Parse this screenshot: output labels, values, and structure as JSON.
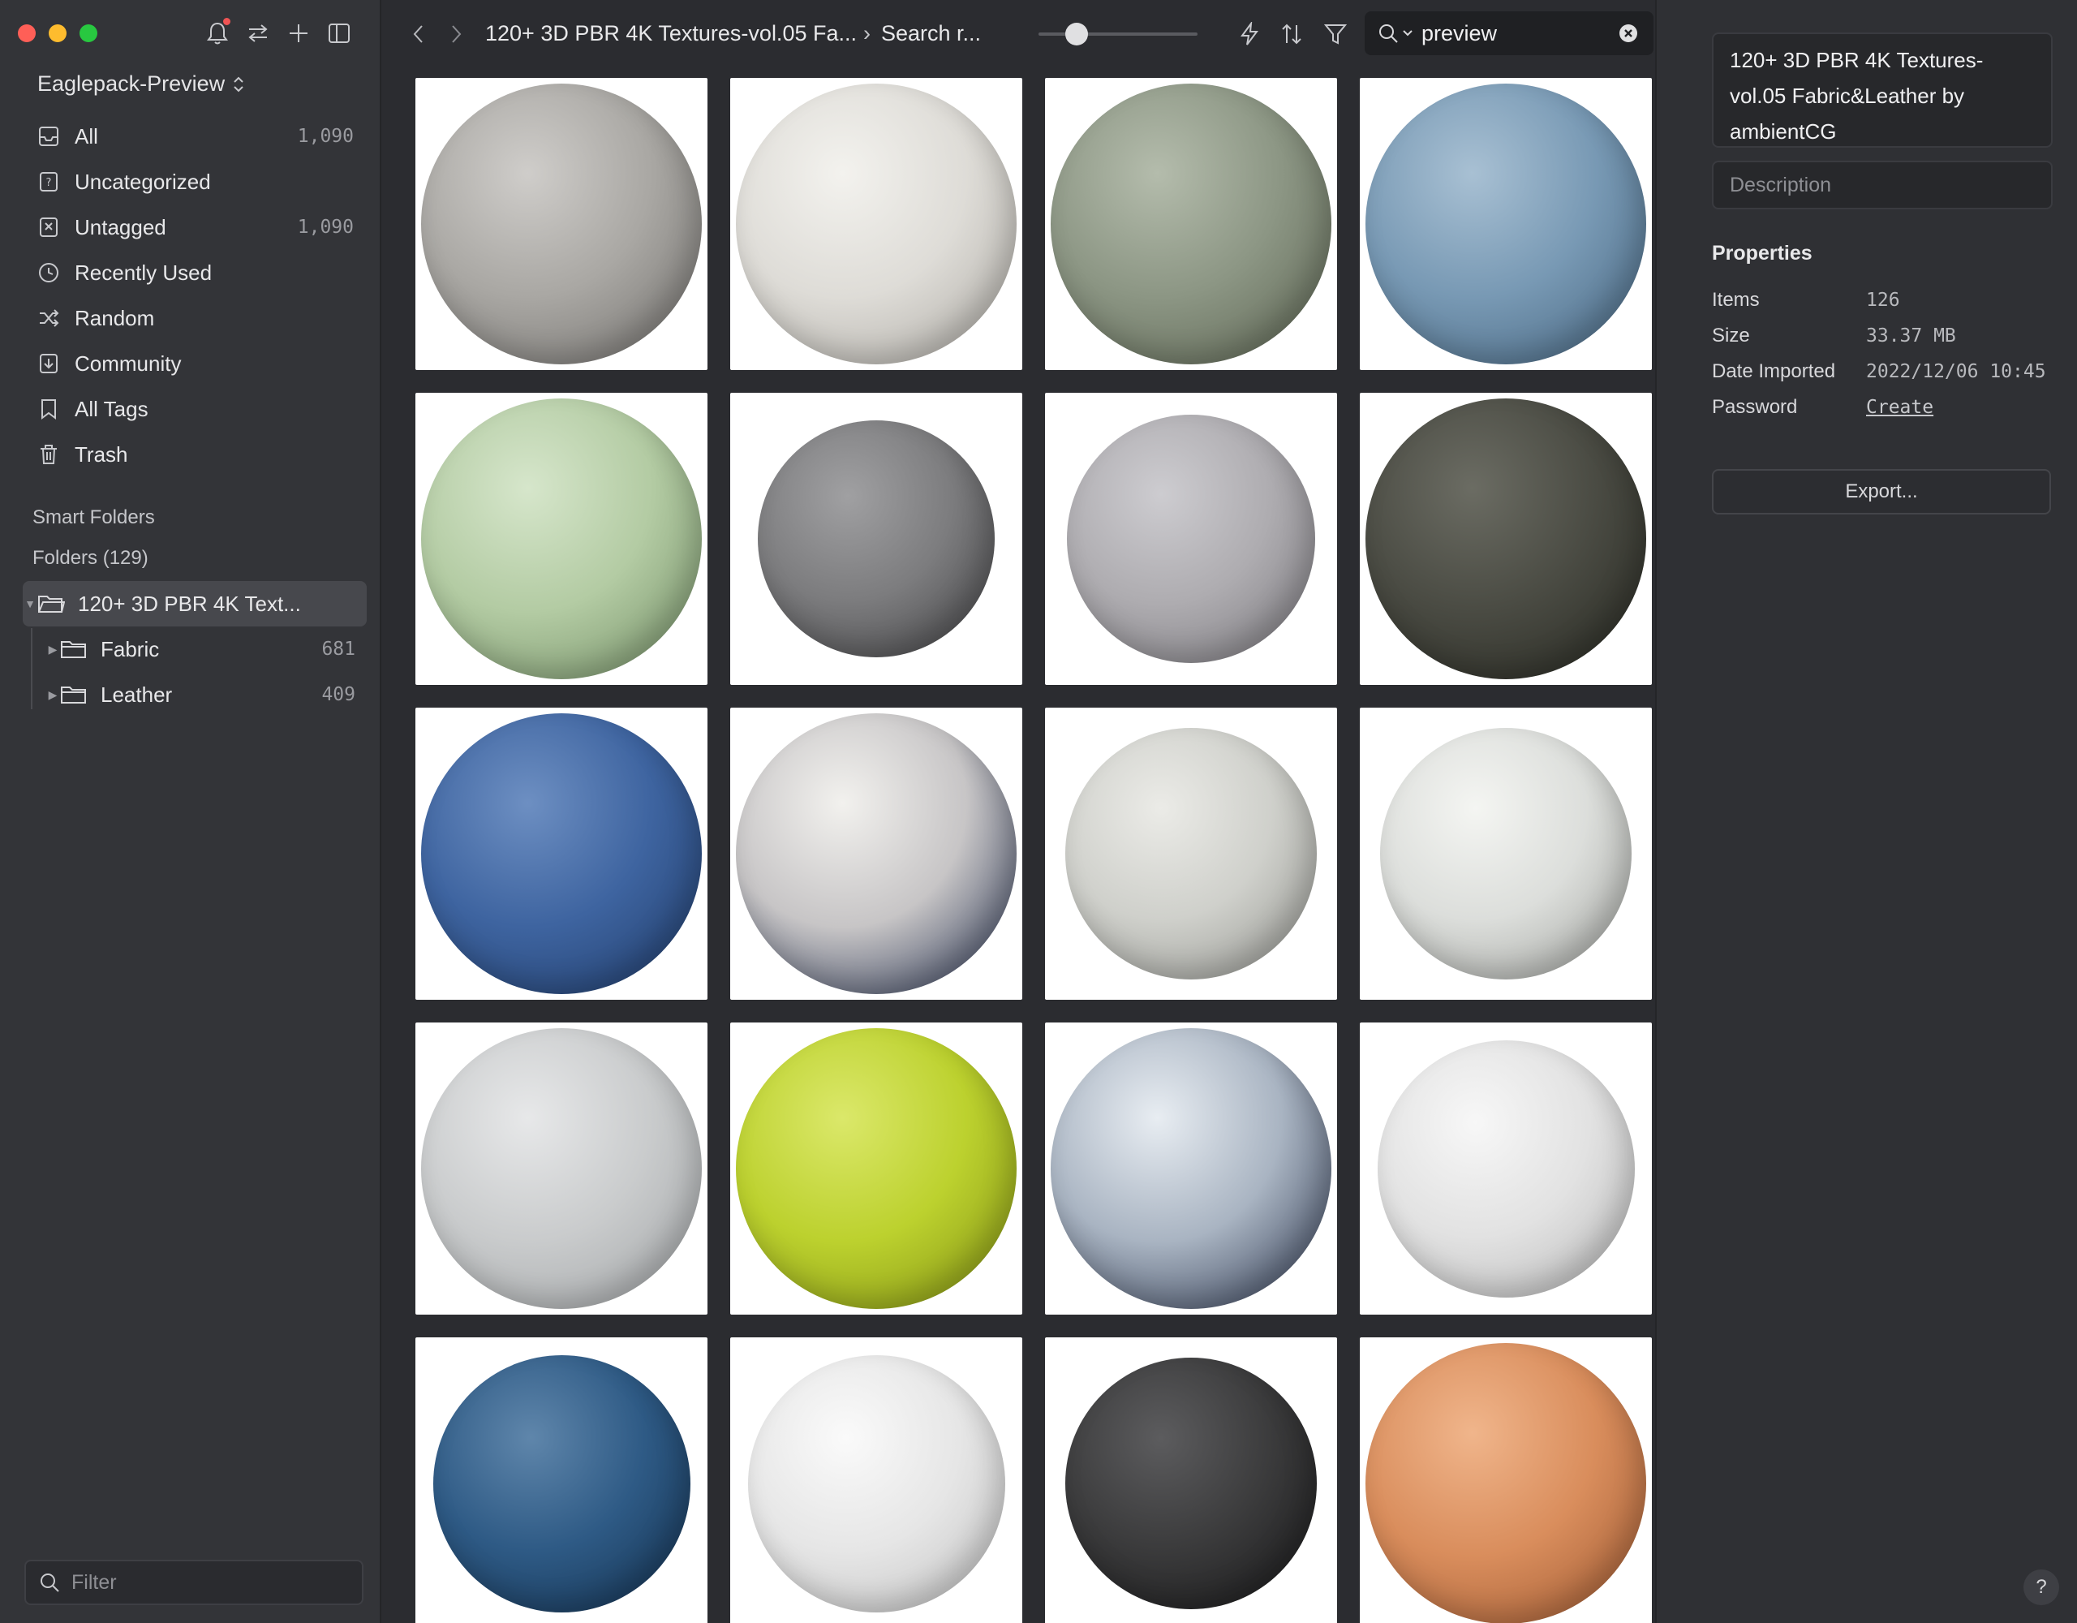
{
  "sidebar": {
    "library": "Eaglepack-Preview",
    "nav": [
      {
        "label": "All",
        "count": "1,090",
        "icon": "inbox-icon"
      },
      {
        "label": "Uncategorized",
        "count": "",
        "icon": "question-folder-icon"
      },
      {
        "label": "Untagged",
        "count": "1,090",
        "icon": "untagged-icon"
      },
      {
        "label": "Recently Used",
        "count": "",
        "icon": "clock-icon"
      },
      {
        "label": "Random",
        "count": "",
        "icon": "shuffle-icon"
      },
      {
        "label": "Community",
        "count": "",
        "icon": "download-box-icon"
      },
      {
        "label": "All Tags",
        "count": "",
        "icon": "bookmark-icon"
      },
      {
        "label": "Trash",
        "count": "",
        "icon": "trash-icon"
      }
    ],
    "smart_folders": "Smart Folders",
    "folders_heading": "Folders (129)",
    "tree": [
      {
        "label": "120+ 3D PBR 4K Text...",
        "count": ""
      },
      {
        "label": "Fabric",
        "count": "681"
      },
      {
        "label": "Leather",
        "count": "409"
      }
    ],
    "filter_placeholder": "Filter"
  },
  "toolbar": {
    "crumb1": "120+ 3D PBR 4K Textures-vol.05 Fa...",
    "crumb2": "Search r...",
    "search_value": "preview",
    "zoom_level": 0.17
  },
  "grid": {
    "items": [
      {
        "color": "#a9a7a3",
        "light": "#cfcdca",
        "dark": "#6e6c69",
        "r": 0.96
      },
      {
        "color": "#dedcd7",
        "light": "#f3f2ee",
        "dark": "#a8a59f",
        "r": 0.96
      },
      {
        "color": "#8c9684",
        "light": "#b4bcac",
        "dark": "#59614f",
        "r": 0.96
      },
      {
        "color": "#7899b4",
        "light": "#a8c0d3",
        "dark": "#44627c",
        "r": 0.96
      },
      {
        "color": "#b3cba3",
        "light": "#d6e6cb",
        "dark": "#6f8a62",
        "r": 0.96
      },
      {
        "color": "#7c7c7e",
        "light": "#a0a0a2",
        "dark": "#3f3f41",
        "r": 0.81
      },
      {
        "color": "#aeacb0",
        "light": "#cdccd0",
        "dark": "#77757a",
        "r": 0.85
      },
      {
        "color": "#4a4b43",
        "light": "#6b6c63",
        "dark": "#25261f",
        "r": 0.96
      },
      {
        "color": "#3e64a0",
        "light": "#6d8fc2",
        "dark": "#1f3a66",
        "r": 0.96
      },
      {
        "color": "#c7c5c6",
        "light": "#f2f1ee",
        "dark": "#1e2a4a",
        "r": 0.96
      },
      {
        "color": "#cfd0cb",
        "light": "#ebebe7",
        "dark": "#8f908b",
        "r": 0.86
      },
      {
        "color": "#dcdedb",
        "light": "#f4f5f2",
        "dark": "#9b9d99",
        "r": 0.86
      },
      {
        "color": "#c9cbcc",
        "light": "#e7e8e9",
        "dark": "#9ea1a3",
        "r": 0.96
      },
      {
        "color": "#bcd12e",
        "light": "#dbe86a",
        "dark": "#7e8d12",
        "r": 0.96
      },
      {
        "color": "#a9b4c2",
        "light": "#e8edf2",
        "dark": "#263048",
        "r": 0.96
      },
      {
        "color": "#e2e2e2",
        "light": "#f7f7f7",
        "dark": "#b4b4b4",
        "r": 0.88
      },
      {
        "color": "#2e5a85",
        "light": "#5f86ab",
        "dark": "#132f4c",
        "r": 0.88
      },
      {
        "color": "#e6e6e6",
        "light": "#fafafa",
        "dark": "#bdbdbd",
        "r": 0.88
      },
      {
        "color": "#3b3b3c",
        "light": "#5c5c5e",
        "dark": "#161617",
        "r": 0.86
      },
      {
        "color": "#d98d5c",
        "light": "#f0b58b",
        "dark": "#9a5630",
        "r": 0.96
      }
    ]
  },
  "inspector": {
    "title": "120+ 3D PBR 4K Textures-vol.05 Fabric&Leather by ambientCG",
    "description_placeholder": "Description",
    "properties_heading": "Properties",
    "props": [
      {
        "key": "Items",
        "value": "126"
      },
      {
        "key": "Size",
        "value": "33.37 MB"
      },
      {
        "key": "Date Imported",
        "value": "2022/12/06 10:45"
      },
      {
        "key": "Password",
        "value": "Create"
      }
    ],
    "export_label": "Export...",
    "help_label": "?"
  },
  "colors": {
    "close": "#ff5f57",
    "minimize": "#febc2e",
    "zoom": "#28c840"
  }
}
